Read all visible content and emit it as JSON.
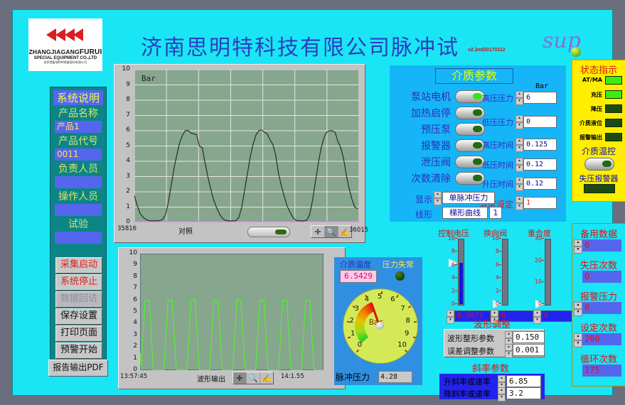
{
  "header": {
    "title": "济南思明特科技有限公司脉冲试验",
    "version": "v2.2ed20170112",
    "sup": "sup",
    "logo": {
      "line1": "ZHANGJIAGANG",
      "line1b": "FURUI",
      "line2": "SPECIAL EQUIPMENT CO.,LTD",
      "line3": "张家港富瑞特种装备股份有限公司"
    }
  },
  "sidebar": {
    "heading": "系统说明",
    "fields": [
      {
        "label": "产品名称",
        "value": "产品1"
      },
      {
        "label": "产品代号",
        "value": "0011"
      },
      {
        "label": "负责人员",
        "value": ""
      },
      {
        "label": "操作人员",
        "value": ""
      },
      {
        "label": "试验",
        "value": ""
      }
    ],
    "buttons": [
      {
        "label": "采集启动",
        "style": "red"
      },
      {
        "label": "系统停止",
        "style": "red"
      },
      {
        "label": "数据回访",
        "style": "dim"
      },
      {
        "label": "保存设置",
        "style": "normal"
      },
      {
        "label": "打印页面",
        "style": "normal"
      },
      {
        "label": "预警开始",
        "style": "normal"
      },
      {
        "label": "报告输出PDF",
        "style": "wide"
      }
    ]
  },
  "chart_data": [
    {
      "type": "line",
      "title": "对照",
      "unit_label": "Bar",
      "ylabel": "Bar",
      "ylim": [
        0,
        10
      ],
      "yticks": [
        "0",
        "1",
        "2",
        "3",
        "4",
        "5",
        "6",
        "7",
        "8",
        "9",
        "10"
      ],
      "x_start": "35816",
      "x_end": "36015",
      "series": [
        {
          "name": "对照",
          "color": "#222222",
          "values": [
            1.75,
            1.1,
            0.6,
            0.35,
            0.2,
            0.12,
            0.1,
            0.1,
            0.1,
            0.12,
            0.2,
            0.5,
            1.3,
            2.4,
            3.5,
            4.4,
            5.2,
            5.7,
            6.0,
            6.02,
            5.85,
            5.8,
            5.75,
            5.0,
            4.9,
            3.9,
            3.0,
            2.2,
            1.5,
            1.0,
            0.6,
            0.3,
            0.15,
            0.1,
            0.1,
            0.1,
            0.12,
            0.35,
            1.0,
            2.1,
            3.2,
            4.3,
            5.1,
            5.7,
            6.0,
            6.05,
            5.9,
            5.8,
            5.4,
            5.1,
            4.4,
            3.2,
            2.4,
            1.7,
            1.1,
            0.7,
            0.35,
            0.15,
            0.1,
            0.1,
            0.1,
            0.15,
            0.5,
            1.4,
            2.6,
            3.8,
            4.8,
            5.5,
            5.9,
            6.0,
            6.0,
            5.9,
            5.3,
            4.9,
            4.2,
            3.1,
            2.2,
            1.5,
            1.0,
            0.9
          ]
        }
      ]
    },
    {
      "type": "line",
      "title": "波形输出",
      "ylim": [
        0,
        10
      ],
      "yticks": [
        "0",
        "1",
        "2",
        "3",
        "4",
        "5",
        "6",
        "7",
        "8",
        "9",
        "10"
      ],
      "x_start": "13:57:45",
      "x_end": "14:1.55",
      "waveform": {
        "color": "#55ee33",
        "cycles": 8,
        "high": 6,
        "low": 0,
        "shape": "trapezoid"
      }
    }
  ],
  "chart_toolbar": {
    "crosshair": "crosshair-tool",
    "zoom": "zoom-tool",
    "pan": "pan-tool"
  },
  "media_params": {
    "title": "介质参数",
    "unit": "Bar",
    "switches": [
      {
        "label": "泵站电机",
        "on": true
      },
      {
        "label": "加热启停",
        "on": false
      },
      {
        "label": "预压泵",
        "on": false
      },
      {
        "label": "报警器",
        "on": false
      },
      {
        "label": "泄压阀",
        "on": false
      },
      {
        "label": "次数清除",
        "on": false
      }
    ],
    "numbers": [
      {
        "label": "高压压力",
        "value": "6"
      },
      {
        "label": "低压压力",
        "value": "0"
      },
      {
        "label": "高压时间",
        "value": "0.125"
      },
      {
        "label": "低压时间",
        "value": "0.12"
      },
      {
        "label": "升压时间",
        "value": "0.12"
      }
    ],
    "temp_set": {
      "label": "温度设定",
      "value": "1"
    },
    "display": {
      "label": "显示",
      "value": "单脉冲压力"
    },
    "linetype": {
      "label": "线形",
      "value": "梯形曲线",
      "index": "1"
    }
  },
  "gauge_panel": {
    "temp_label": "介质温度",
    "temp_value": "6.5429",
    "alarm_label": "压力失常",
    "gauge_unit": "Bar",
    "gauge_ticks": [
      "0",
      "1",
      "2",
      "3",
      "4",
      "5",
      "6",
      "7",
      "8",
      "9",
      "10"
    ],
    "gauge_value": 4.28,
    "pulse_label": "脉冲压力",
    "pulse_value": "4.28"
  },
  "sliders": [
    {
      "label": "控制电压",
      "value": "6.3071",
      "max": 10,
      "pos": 6.3,
      "ticks": [
        "10",
        "8",
        "6",
        "4",
        "2",
        "0"
      ],
      "filled": true
    },
    {
      "label": "换向阀",
      "value": "0",
      "max": 10,
      "pos": 0,
      "ticks": [
        "10",
        "8",
        "6",
        "4",
        "2",
        "0"
      ],
      "filled": false
    },
    {
      "label": "重合度",
      "value": "0",
      "max": 30,
      "pos": 0,
      "ticks": [
        "30",
        "20",
        "10",
        "0"
      ],
      "filled": false
    }
  ],
  "wave_adjust": {
    "title": "波形调整",
    "rows": [
      {
        "label": "波形整形参数",
        "value": "0.150"
      },
      {
        "label": "误差调整参数",
        "value": "0.001"
      }
    ]
  },
  "slope_params": {
    "title": "斜率参数",
    "rows": [
      {
        "label": "升斜率或速率",
        "value": "6.85"
      },
      {
        "label": "降斜率或速率",
        "value": "3.2"
      }
    ]
  },
  "status_panel": {
    "title": "状态指示",
    "items": [
      {
        "label": "AT/MA",
        "on": true
      },
      {
        "label": "充压",
        "on": true
      },
      {
        "label": "降压",
        "on": false
      },
      {
        "label": "介质液位",
        "on": false
      },
      {
        "label": "报警输出",
        "on": false
      }
    ],
    "temp_control": "介质温控",
    "temp_control_on": false,
    "depress_alarm": "失压报警器"
  },
  "counters": [
    {
      "label": "备用数据",
      "value": "0",
      "spinner": true
    },
    {
      "label": "失压次数",
      "value": "0",
      "spinner": false
    },
    {
      "label": "报警压力",
      "value": "0",
      "spinner": true
    },
    {
      "label": "设定次数",
      "value": "200",
      "spinner": true
    },
    {
      "label": "循环次数",
      "value": "175",
      "spinner": false
    }
  ]
}
